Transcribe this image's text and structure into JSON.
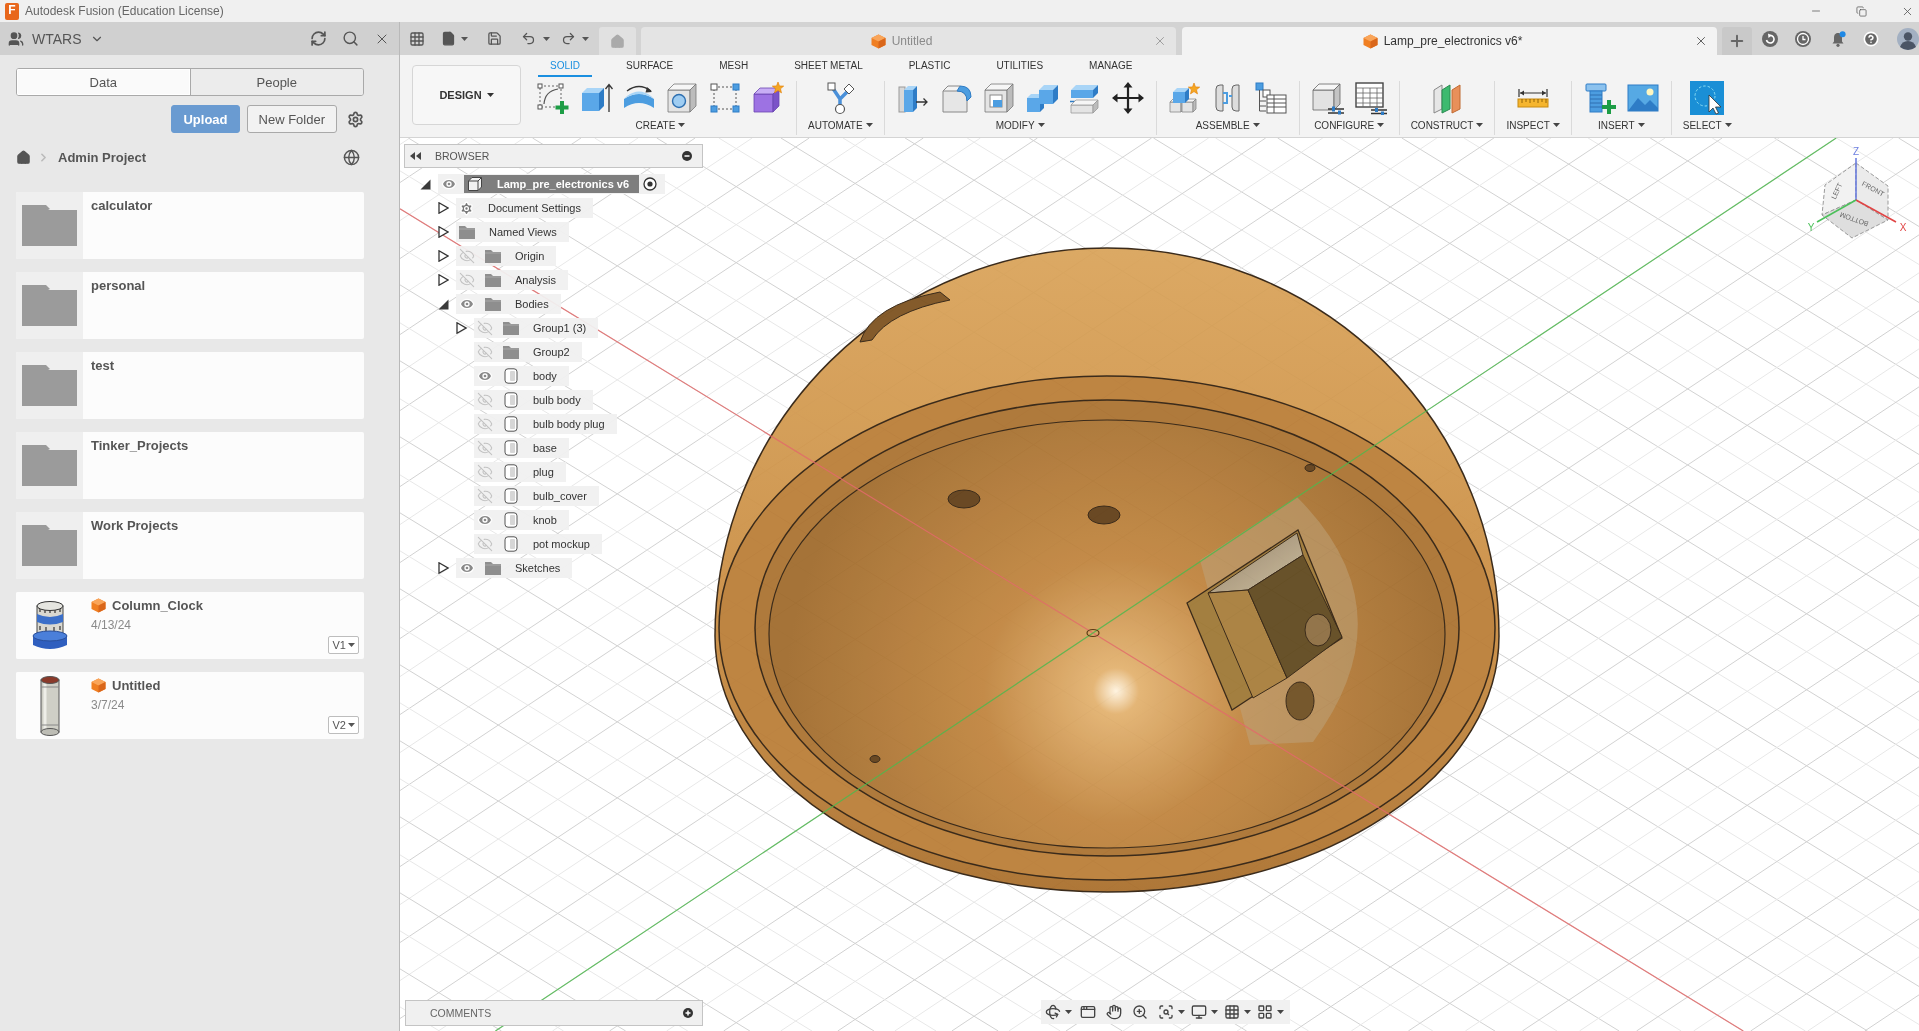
{
  "app": {
    "logo": "F",
    "title": "Autodesk Fusion (Education License)"
  },
  "data_panel": {
    "team": "WTARS",
    "tabs": [
      {
        "label": "Data",
        "selected": true
      },
      {
        "label": "People",
        "selected": false
      }
    ],
    "actions": [
      {
        "label": "Upload",
        "kind": "primary"
      },
      {
        "label": "New Folder",
        "kind": "secondary"
      }
    ],
    "breadcrumb": "Admin Project",
    "items": [
      {
        "kind": "folder",
        "name": "calculator"
      },
      {
        "kind": "folder",
        "name": "personal"
      },
      {
        "kind": "folder",
        "name": "test"
      },
      {
        "kind": "folder",
        "name": "Tinker_Projects"
      },
      {
        "kind": "folder",
        "name": "Work Projects"
      },
      {
        "kind": "design",
        "name": "Column_Clock",
        "date": "4/13/24",
        "version": "V1"
      },
      {
        "kind": "design",
        "name": "Untitled",
        "date": "3/7/24",
        "version": "V2"
      }
    ]
  },
  "document_tabs": [
    {
      "label": "Untitled",
      "selected": false
    },
    {
      "label": "Lamp_pre_electronics v6*",
      "selected": true
    }
  ],
  "toolbar": {
    "workspace": "DESIGN",
    "tabs": [
      {
        "label": "SOLID",
        "selected": true
      },
      {
        "label": "SURFACE",
        "selected": false
      },
      {
        "label": "MESH",
        "selected": false
      },
      {
        "label": "SHEET METAL",
        "selected": false
      },
      {
        "label": "PLASTIC",
        "selected": false
      },
      {
        "label": "UTILITIES",
        "selected": false
      },
      {
        "label": "MANAGE",
        "selected": false
      }
    ],
    "groups": [
      {
        "label": "CREATE"
      },
      {
        "label": "AUTOMATE"
      },
      {
        "label": "MODIFY"
      },
      {
        "label": "ASSEMBLE"
      },
      {
        "label": "CONFIGURE"
      },
      {
        "label": "CONSTRUCT"
      },
      {
        "label": "INSPECT"
      },
      {
        "label": "INSERT"
      },
      {
        "label": "SELECT"
      }
    ]
  },
  "browser": {
    "title": "BROWSER",
    "tree": [
      {
        "label": "Lamp_pre_electronics v6",
        "kind": "component",
        "visible": true,
        "expanded": true,
        "selected": true,
        "children": [
          {
            "label": "Document Settings",
            "kind": "settings",
            "expanded": false,
            "selected": false
          },
          {
            "label": "Named Views",
            "kind": "folder",
            "expanded": false,
            "selected": false
          },
          {
            "label": "Origin",
            "kind": "folder",
            "visible": false,
            "expanded": false,
            "selected": false
          },
          {
            "label": "Analysis",
            "kind": "folder",
            "visible": false,
            "expanded": false,
            "selected": false
          },
          {
            "label": "Bodies",
            "kind": "folder",
            "visible": true,
            "expanded": true,
            "selected": false,
            "children": [
              {
                "label": "Group1 (3)",
                "kind": "folder",
                "visible": false,
                "expanded": false,
                "selected": false
              },
              {
                "label": "Group2",
                "kind": "folder",
                "visible": false,
                "selected": false
              },
              {
                "label": "body",
                "kind": "body",
                "visible": true,
                "selected": false
              },
              {
                "label": "bulb body",
                "kind": "body",
                "visible": false,
                "selected": false
              },
              {
                "label": "bulb body plug",
                "kind": "body",
                "visible": false,
                "selected": false
              },
              {
                "label": "base",
                "kind": "body",
                "visible": false,
                "selected": false
              },
              {
                "label": "plug",
                "kind": "body",
                "visible": false,
                "selected": false
              },
              {
                "label": "bulb_cover",
                "kind": "body",
                "visible": false,
                "selected": false
              },
              {
                "label": "knob",
                "kind": "body",
                "visible": true,
                "selected": false
              },
              {
                "label": "pot mockup",
                "kind": "body",
                "visible": false,
                "selected": false
              }
            ]
          },
          {
            "label": "Sketches",
            "kind": "folder",
            "visible": true,
            "expanded": false,
            "selected": false
          }
        ]
      }
    ]
  },
  "viewcube": {
    "faces": [
      "LEFT",
      "FRONT",
      "BOTTOM"
    ],
    "axes": [
      "Z",
      "X",
      "Y"
    ]
  },
  "comments": {
    "title": "COMMENTS"
  }
}
